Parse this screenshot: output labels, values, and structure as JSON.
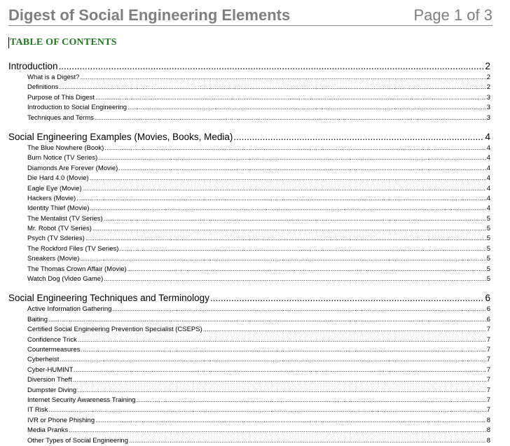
{
  "header": {
    "title": "Digest of Social Engineering Elements",
    "page": "Page 1 of 3"
  },
  "toc": {
    "heading": "TABLE OF CONTENTS",
    "sections": [
      {
        "title": "Introduction",
        "page": "2",
        "items": [
          {
            "title": "What is a Digest?",
            "page": "2"
          },
          {
            "title": "Definitions",
            "page": "2"
          },
          {
            "title": "Purpose of This Digest",
            "page": "3"
          },
          {
            "title": "Introduction to Social Engineering",
            "page": "3"
          },
          {
            "title": "Techniques and Terms",
            "page": "3"
          }
        ]
      },
      {
        "title": "Social Engineering Examples (Movies, Books, Media)",
        "page": "4",
        "items": [
          {
            "title": "The Blue Nowhere (Book)",
            "page": "4"
          },
          {
            "title": "Burn Notice (TV Series)",
            "page": "4"
          },
          {
            "title": "Diamonds Are Forever (Movie)",
            "page": "4"
          },
          {
            "title": "Die Hard 4.0 (Movie)",
            "page": "4"
          },
          {
            "title": "Eagle Eye (Movie)",
            "page": "4"
          },
          {
            "title": "Hackers (Movie)",
            "page": "4"
          },
          {
            "title": "Identity Thief (Movie)",
            "page": "4"
          },
          {
            "title": "The Mentalist (TV Series)",
            "page": "5"
          },
          {
            "title": "Mr. Robot (TV Series)",
            "page": "5"
          },
          {
            "title": "Psych (TV Sderies)",
            "page": "5"
          },
          {
            "title": "The Rockford Files (TV Series)",
            "page": "5"
          },
          {
            "title": "Sneakers (Movie)",
            "page": "5"
          },
          {
            "title": "The Thomas Crown Affair (Movie)",
            "page": "5"
          },
          {
            "title": "Watch Dog (Video Game)",
            "page": "5"
          }
        ]
      },
      {
        "title": "Social Engineering Techniques and Terminology",
        "page": "6",
        "items": [
          {
            "title": "Active Information Gathering",
            "page": "6"
          },
          {
            "title": "Baiting",
            "page": "6"
          },
          {
            "title": "Certified Social Engineering Prevention Specialist (CSEPS)",
            "page": "7"
          },
          {
            "title": "Confidence Trick",
            "page": "7"
          },
          {
            "title": "Countermeasures",
            "page": "7"
          },
          {
            "title": "Cyberheist",
            "page": "7"
          },
          {
            "title": "Cyber-HUMINT",
            "page": "7"
          },
          {
            "title": "Diversion Theft",
            "page": "7"
          },
          {
            "title": "Dumpster Diving",
            "page": "7"
          },
          {
            "title": "Internet Security Awareness Training",
            "page": "7"
          },
          {
            "title": "IT Risk",
            "page": "7"
          },
          {
            "title": "IVR or Phone Phishing",
            "page": "8"
          },
          {
            "title": "Media Pranks",
            "page": "8"
          },
          {
            "title": "Other Types of Social Engineering",
            "page": "8"
          }
        ]
      }
    ]
  }
}
